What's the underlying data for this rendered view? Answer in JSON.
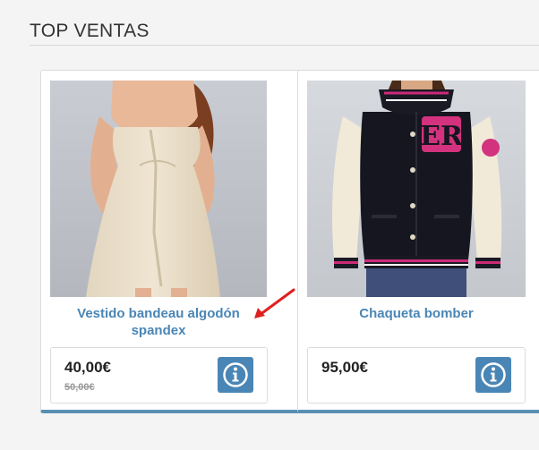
{
  "section": {
    "title": "TOP VENTAS"
  },
  "products": [
    {
      "name": "Vestido bandeau algodón spandex",
      "price": "40,00€",
      "old_price": "50,00€",
      "image_icon": "dress-product-photo",
      "info_icon": "info-icon"
    },
    {
      "name": "Chaqueta bomber",
      "price": "95,00€",
      "image_icon": "jacket-product-photo",
      "info_icon": "info-icon"
    }
  ],
  "colors": {
    "accent": "#4a86b5",
    "card_bottom_border": "#5a8fb4",
    "arrow": "#e02020"
  }
}
